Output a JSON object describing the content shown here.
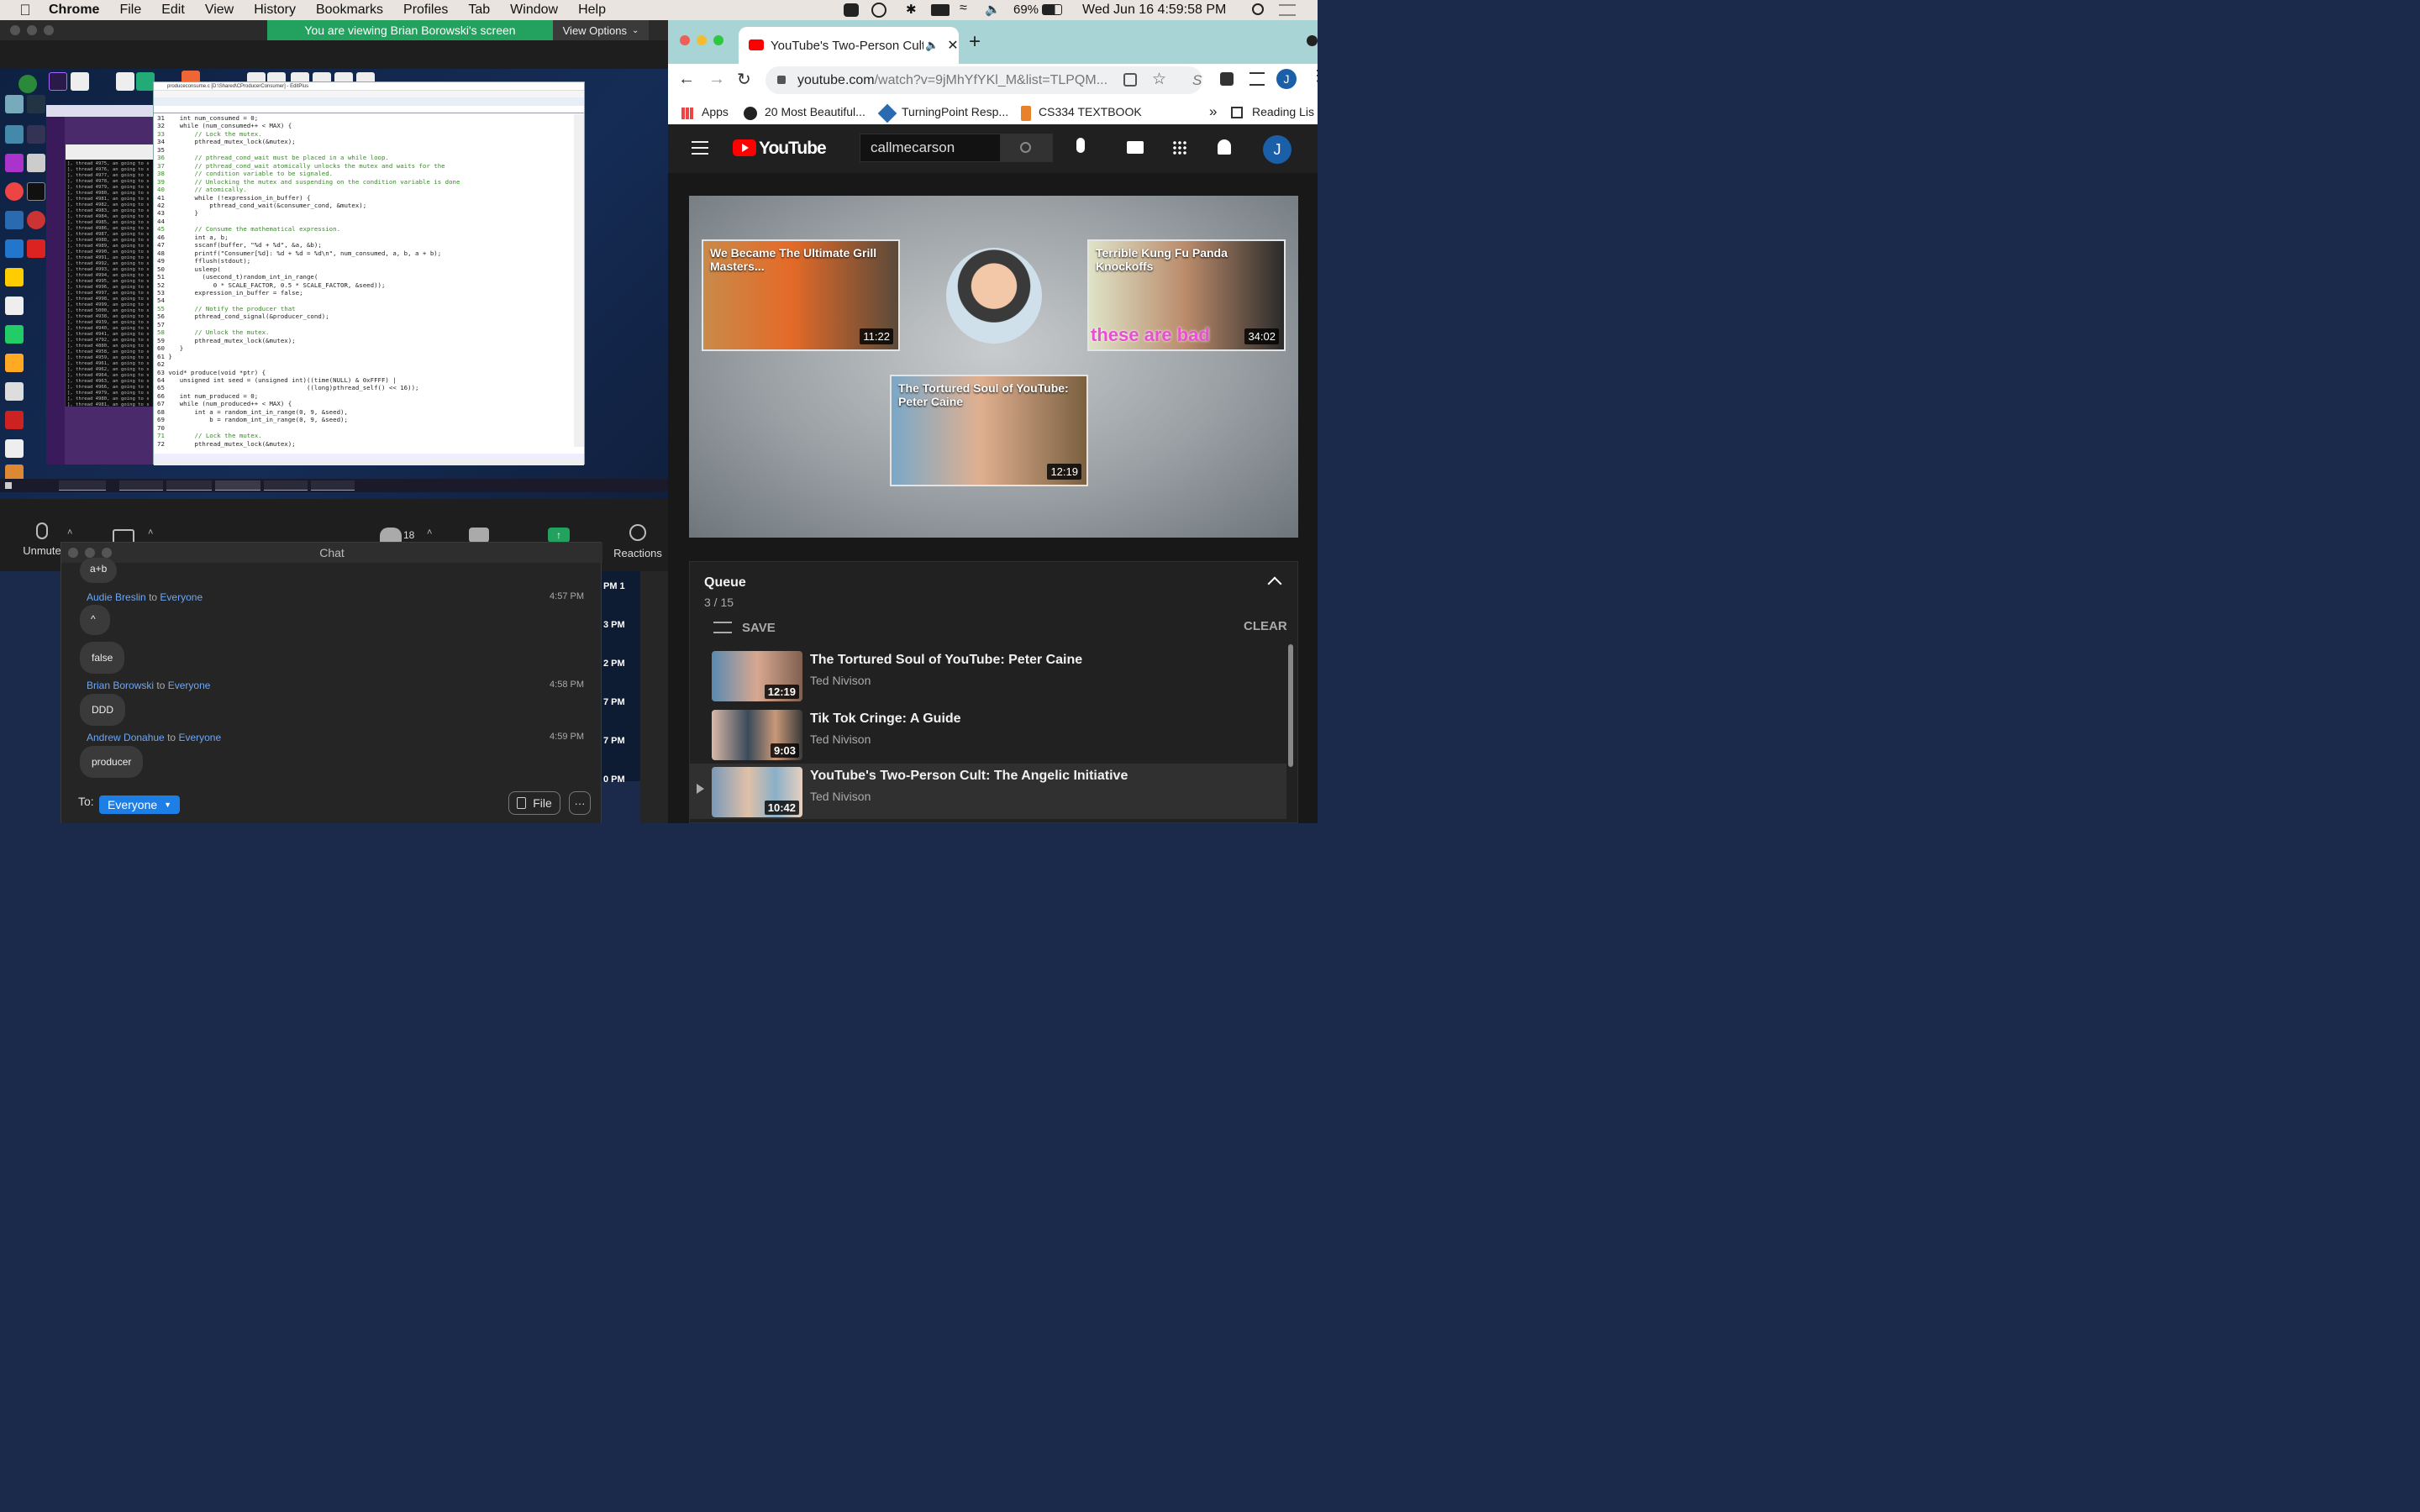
{
  "menubar": {
    "app": "Chrome",
    "items": [
      "File",
      "Edit",
      "View",
      "History",
      "Bookmarks",
      "Profiles",
      "Tab",
      "Window",
      "Help"
    ],
    "battery": "69%",
    "datetime": "Wed Jun 16  4:59:58 PM"
  },
  "zoom": {
    "banner": "You are viewing Brian Borowski's screen",
    "view_options": "View Options",
    "controls": {
      "unmute": "Unmute",
      "participants_count": "18",
      "reactions": "Reactions"
    },
    "shared_screen": {
      "editor_title": "produceconsume.c [D:\\Shared\\CProducerConsumer] - EditPlus",
      "code_lines": [
        "31    int num_consumed = 0;",
        "32    while (num_consumed++ < MAX) {",
        "33        // Lock the mutex.",
        "34        pthread_mutex_lock(&mutex);",
        "35",
        "36        // pthread_cond_wait must be placed in a while loop.",
        "37        // pthread_cond_wait atomically unlocks the mutex and waits for the",
        "38        // condition variable to be signaled.",
        "39        // Unlocking the mutex and suspending on the condition variable is done",
        "40        // atomically.",
        "41        while (!expression_in_buffer) {",
        "42            pthread_cond_wait(&consumer_cond, &mutex);",
        "43        }",
        "44",
        "45        // Consume the mathematical expression.",
        "46        int a, b;",
        "47        sscanf(buffer, \"%d + %d\", &a, &b);",
        "48        printf(\"Consumer[%d]: %d + %d = %d\\n\", num_consumed, a, b, a + b);",
        "49        fflush(stdout);",
        "50        usleep(",
        "51          (usecond_t)random_int_in_range(",
        "52             0 * SCALE_FACTOR, 0.5 * SCALE_FACTOR, &seed));",
        "53        expression_in_buffer = false;",
        "54",
        "55        // Notify the producer that",
        "56        pthread_cond_signal(&producer_cond);",
        "57",
        "58        // Unlock the mutex.",
        "59        pthread_mutex_lock(&mutex);",
        "60    }",
        "61 }",
        "62",
        "63 void* produce(void *ptr) {",
        "64    unsigned int seed = (unsigned int)((time(NULL) & 0xFFFF) |",
        "65                                      ((long)pthread_self() << 16));",
        "66    int num_produced = 0;",
        "67    while (num_produced++ < MAX) {",
        "68        int a = random_int_in_range(0, 9, &seed),",
        "69            b = random_int_in_range(0, 9, &seed);",
        "70",
        "71        // Lock the mutex.",
        "72        pthread_mutex_lock(&mutex);"
      ],
      "terminal_lines": [
        "], thread 4975, an going to s",
        "], thread 4976, an going to s",
        "], thread 4977, an going to s",
        "], thread 4978, an going to s",
        "], thread 4979, an going to s",
        "], thread 4980, an going to s",
        "], thread 4981, an going to s",
        "], thread 4982, an going to s",
        "], thread 4983, an going to s",
        "], thread 4984, an going to s",
        "], thread 4985, an going to s",
        "], thread 4986, an going to s",
        "], thread 4987, an going to s",
        "], thread 4988, an going to s",
        "], thread 4989, an going to s",
        "], thread 4990, an going to s",
        "], thread 4991, an going to s",
        "], thread 4992, an going to s",
        "], thread 4993, an going to s",
        "], thread 4994, an going to s",
        "], thread 4995, an going to s",
        "], thread 4996, an going to s",
        "], thread 4997, an going to s",
        "], thread 4998, an going to s",
        "], thread 4999, an going to s",
        "], thread 5000, an going to s",
        "], thread 4938, an going to s",
        "], thread 4939, an going to s",
        "], thread 4940, an going to s",
        "], thread 4941, an going to s",
        "], thread 4792, an going to s",
        "], thread 4880, an going to s",
        "], thread 4958, an going to s",
        "], thread 4959, an going to s",
        "], thread 4961, an going to s",
        "], thread 4962, an going to s",
        "], thread 4964, an going to s",
        "], thread 4963, an going to s",
        "], thread 4966, an going to s",
        "], thread 4979, an going to s",
        "], thread 4980, an going to s",
        "], thread 4981, an going to s",
        "], thread 4982, an going to s",
        "Num threads started: 5000",
        "Threads still running: 0",
        "user@box:~/shared/CSleepingTh"
      ]
    }
  },
  "chat": {
    "title": "Chat",
    "first_bubble": "a+b",
    "messages": [
      {
        "sender": "Audie Breslin",
        "to": "to",
        "target": "Everyone",
        "time": "4:57 PM",
        "bubbles": [
          "^",
          "false"
        ]
      },
      {
        "sender": "Brian Borowski",
        "to": "to",
        "target": "Everyone",
        "time": "4:58 PM",
        "bubbles": [
          "DDD"
        ]
      },
      {
        "sender": "Andrew Donahue",
        "to": "to",
        "target": "Everyone",
        "time": "4:59 PM",
        "bubbles": [
          "producer"
        ]
      }
    ],
    "to_label": "To:",
    "to_value": "Everyone",
    "file_label": "File",
    "more_label": "···"
  },
  "chrome": {
    "tab_title": "YouTube's Two-Person Cult",
    "url_main": "youtube.com",
    "url_rest": "/watch?v=9jMhYfYKl_M&list=TLPQM...",
    "profile_initial": "J",
    "bookmarks": [
      "Apps",
      "20 Most Beautiful...",
      "TurningPoint Resp...",
      "CS334 TEXTBOOK"
    ],
    "reading_list": "Reading Lis",
    "overflow": "»"
  },
  "youtube": {
    "logo_text": "YouTube",
    "search_value": "callmecarson",
    "avatar_initial": "J",
    "endscreen": [
      {
        "title": "We Became The Ultimate Grill Masters...",
        "duration": "11:22"
      },
      {
        "title": "Terrible Kung Fu Panda Knockoffs",
        "duration": "34:02",
        "caption": "these are bad"
      },
      {
        "title": "The Tortured Soul of YouTube: Peter Caine",
        "duration": "12:19"
      }
    ],
    "queue": {
      "title": "Queue",
      "position": "3 / 15",
      "save_label": "SAVE",
      "clear_label": "CLEAR",
      "items": [
        {
          "title": "The Tortured Soul of YouTube: Peter Caine",
          "channel": "Ted Nivison",
          "duration": "12:19"
        },
        {
          "title": "Tik Tok Cringe: A Guide",
          "channel": "Ted Nivison",
          "duration": "9:03"
        },
        {
          "title": "YouTube's Two-Person Cult: The Angelic Initiative",
          "channel": "Ted Nivison",
          "duration": "10:42"
        }
      ]
    }
  },
  "strip_times": [
    "PM 1",
    "3 PM",
    "2 PM",
    "7 PM",
    "7 PM",
    "0 PM"
  ]
}
